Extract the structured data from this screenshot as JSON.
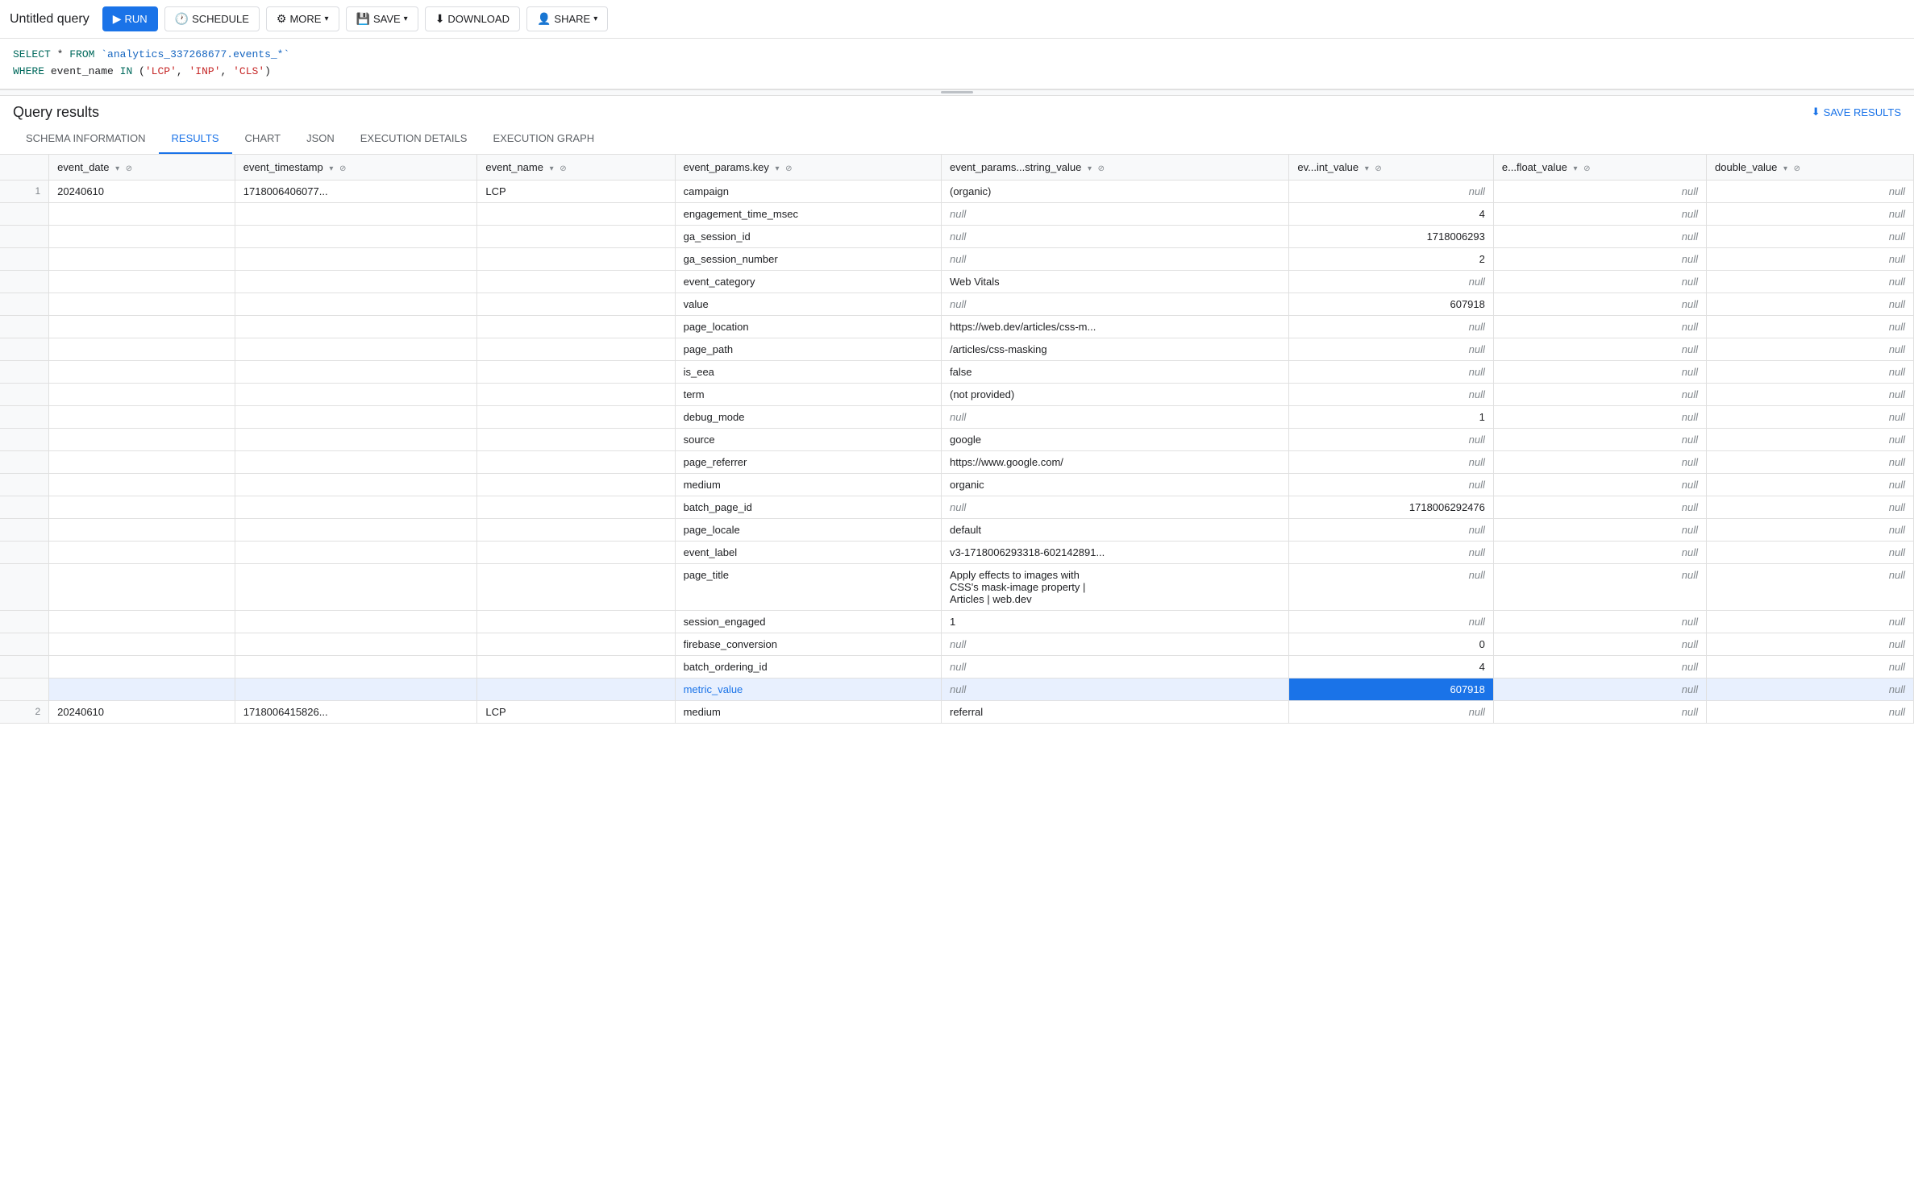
{
  "title": "Untitled query",
  "toolbar": {
    "run_label": "RUN",
    "schedule_label": "SCHEDULE",
    "more_label": "MORE",
    "save_label": "SAVE",
    "download_label": "DOWNLOAD",
    "share_label": "SHARE"
  },
  "sql": {
    "line1": "SELECT * FROM `analytics_337268677.events_*`",
    "line2": "WHERE event_name IN ('LCP', 'INP', 'CLS')"
  },
  "results": {
    "title": "Query results",
    "save_results_label": "SAVE RESULTS"
  },
  "tabs": [
    {
      "id": "schema",
      "label": "SCHEMA INFORMATION"
    },
    {
      "id": "results",
      "label": "RESULTS",
      "active": true
    },
    {
      "id": "chart",
      "label": "CHART"
    },
    {
      "id": "json",
      "label": "JSON"
    },
    {
      "id": "execution_details",
      "label": "EXECUTION DETAILS"
    },
    {
      "id": "execution_graph",
      "label": "EXECUTION GRAPH"
    }
  ],
  "columns": [
    {
      "id": "rownum",
      "label": ""
    },
    {
      "id": "event_date",
      "label": "event_date",
      "sortable": true,
      "filterable": true
    },
    {
      "id": "event_timestamp",
      "label": "event_timestamp",
      "sortable": true,
      "filterable": true
    },
    {
      "id": "event_name",
      "label": "event_name",
      "sortable": true,
      "filterable": true
    },
    {
      "id": "event_params_key",
      "label": "event_params.key",
      "sortable": true,
      "filterable": true
    },
    {
      "id": "event_params_string_value",
      "label": "event_params...string_value",
      "sortable": true,
      "filterable": true
    },
    {
      "id": "ev_int_value",
      "label": "ev...int_value",
      "sortable": true,
      "filterable": true
    },
    {
      "id": "e_float_value",
      "label": "e...float_value",
      "sortable": true,
      "filterable": true
    },
    {
      "id": "double_value",
      "label": "double_value",
      "sortable": true,
      "filterable": true
    }
  ],
  "rows": [
    {
      "rownum": "1",
      "event_date": "20240610",
      "event_timestamp": "1718006406077...",
      "event_name": "LCP",
      "subrows": [
        {
          "key": "campaign",
          "string_value": "(organic)",
          "int_value": "null",
          "float_value": "null",
          "double_value": "null",
          "highlighted": false
        },
        {
          "key": "engagement_time_msec",
          "string_value": "null",
          "int_value": "4",
          "float_value": "null",
          "double_value": "null",
          "highlighted": false
        },
        {
          "key": "ga_session_id",
          "string_value": "null",
          "int_value": "1718006293",
          "float_value": "null",
          "double_value": "null",
          "highlighted": false
        },
        {
          "key": "ga_session_number",
          "string_value": "null",
          "int_value": "2",
          "float_value": "null",
          "double_value": "null",
          "highlighted": false
        },
        {
          "key": "event_category",
          "string_value": "Web Vitals",
          "int_value": "null",
          "float_value": "null",
          "double_value": "null",
          "highlighted": false
        },
        {
          "key": "value",
          "string_value": "null",
          "int_value": "607918",
          "float_value": "null",
          "double_value": "null",
          "highlighted": false
        },
        {
          "key": "page_location",
          "string_value": "https://web.dev/articles/css-m...",
          "int_value": "null",
          "float_value": "null",
          "double_value": "null",
          "highlighted": false
        },
        {
          "key": "page_path",
          "string_value": "/articles/css-masking",
          "int_value": "null",
          "float_value": "null",
          "double_value": "null",
          "highlighted": false
        },
        {
          "key": "is_eea",
          "string_value": "false",
          "int_value": "null",
          "float_value": "null",
          "double_value": "null",
          "highlighted": false
        },
        {
          "key": "term",
          "string_value": "(not provided)",
          "int_value": "null",
          "float_value": "null",
          "double_value": "null",
          "highlighted": false
        },
        {
          "key": "debug_mode",
          "string_value": "null",
          "int_value": "1",
          "float_value": "null",
          "double_value": "null",
          "highlighted": false
        },
        {
          "key": "source",
          "string_value": "google",
          "int_value": "null",
          "float_value": "null",
          "double_value": "null",
          "highlighted": false
        },
        {
          "key": "page_referrer",
          "string_value": "https://www.google.com/",
          "int_value": "null",
          "float_value": "null",
          "double_value": "null",
          "highlighted": false
        },
        {
          "key": "medium",
          "string_value": "organic",
          "int_value": "null",
          "float_value": "null",
          "double_value": "null",
          "highlighted": false
        },
        {
          "key": "batch_page_id",
          "string_value": "null",
          "int_value": "1718006292476",
          "float_value": "null",
          "double_value": "null",
          "highlighted": false
        },
        {
          "key": "page_locale",
          "string_value": "default",
          "int_value": "null",
          "float_value": "null",
          "double_value": "null",
          "highlighted": false
        },
        {
          "key": "event_label",
          "string_value": "v3-1718006293318-602142891...",
          "int_value": "null",
          "float_value": "null",
          "double_value": "null",
          "highlighted": false
        },
        {
          "key": "page_title",
          "string_value": "Apply effects to images with\nCSS's mask-image property  |\nArticles | web.dev",
          "int_value": "null",
          "float_value": "null",
          "double_value": "null",
          "highlighted": false
        },
        {
          "key": "session_engaged",
          "string_value": "1",
          "int_value": "null",
          "float_value": "null",
          "double_value": "null",
          "highlighted": false
        },
        {
          "key": "firebase_conversion",
          "string_value": "null",
          "int_value": "0",
          "float_value": "null",
          "double_value": "null",
          "highlighted": false
        },
        {
          "key": "batch_ordering_id",
          "string_value": "null",
          "int_value": "4",
          "float_value": "null",
          "double_value": "null",
          "highlighted": false
        },
        {
          "key": "metric_value",
          "string_value": "null",
          "int_value": "607918",
          "float_value": "null",
          "double_value": "null",
          "highlighted": true,
          "key_highlighted": true,
          "string_highlighted": true,
          "int_selected": true,
          "float_highlighted": true,
          "double_highlighted": true
        }
      ]
    },
    {
      "rownum": "2",
      "event_date": "20240610",
      "event_timestamp": "1718006415826...",
      "event_name": "LCP",
      "subrows": [
        {
          "key": "medium",
          "string_value": "referral",
          "int_value": "null",
          "float_value": "null",
          "double_value": "null",
          "highlighted": false
        }
      ]
    }
  ]
}
